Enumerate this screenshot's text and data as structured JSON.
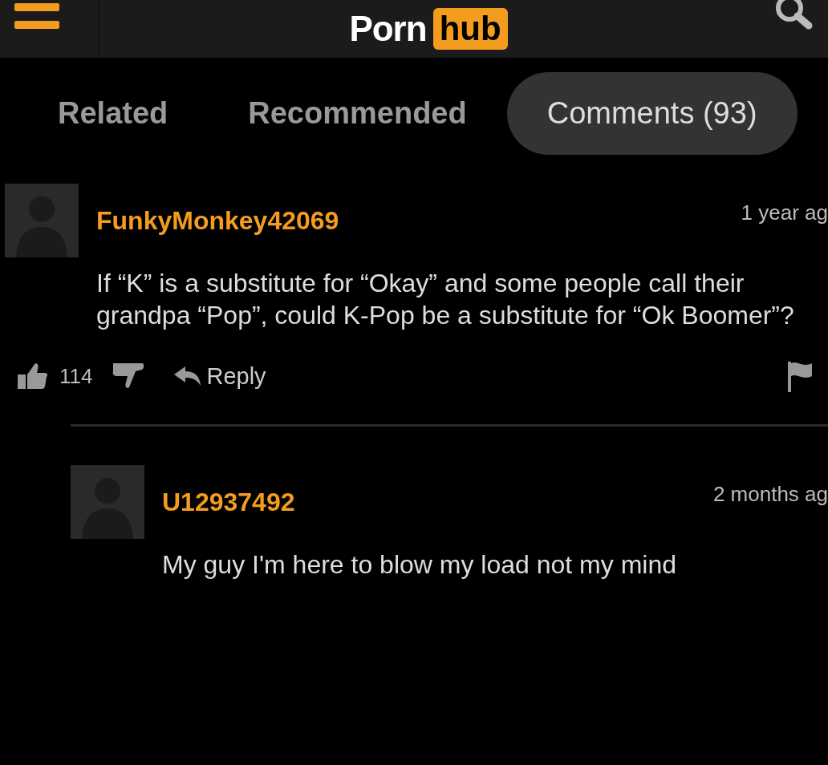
{
  "header": {
    "logo_left": "Porn",
    "logo_right": "hub"
  },
  "tabs": [
    {
      "label": "Related",
      "selected": false
    },
    {
      "label": "Recommended",
      "selected": false
    },
    {
      "label": "Comments (93)",
      "selected": true
    }
  ],
  "comments": [
    {
      "user": "FunkyMonkey42069",
      "time": "1 year ag",
      "text": "If “K” is a substitute for “Okay” and some people call their grandpa “Pop”, could K-Pop be a substitute for “Ok Boomer”?",
      "likes": "114",
      "reply_label": "Reply",
      "children": [
        {
          "user": "U12937492",
          "time": "2 months ag",
          "text": "My guy I'm here to blow my load not my mind"
        }
      ]
    }
  ]
}
